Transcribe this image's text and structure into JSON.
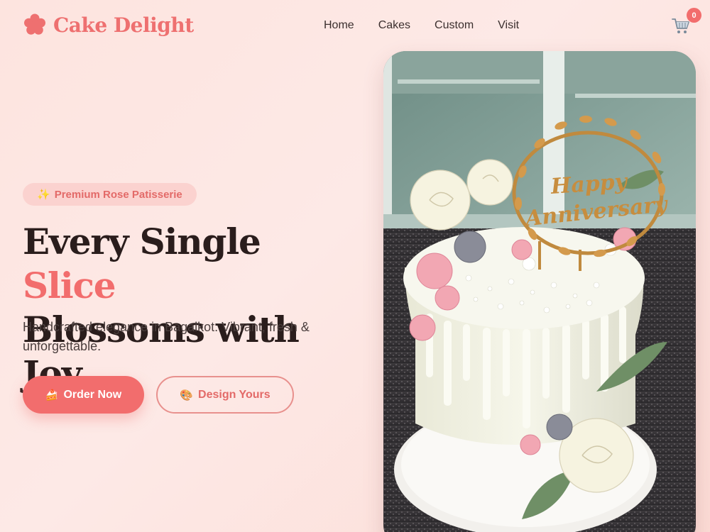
{
  "brand": {
    "name": "Cake Delight",
    "icon": "flower-icon",
    "color": "#ee7070"
  },
  "nav": {
    "items": [
      "Home",
      "Cakes",
      "Custom",
      "Visit"
    ]
  },
  "cart": {
    "icon": "cart-icon",
    "count": "0"
  },
  "hero": {
    "tag": {
      "icon": "sparkles",
      "text": "Premium Rose Patisserie"
    },
    "headline": {
      "part1": "Every Single ",
      "accent": "Slice",
      "line2": "Blossoms with Joy"
    },
    "subtext": "Handcrafted elegance in Bagalkot. Vibrant, fresh & unforgettable.",
    "primary_button": {
      "emoji": "🍰",
      "label": "Order Now"
    },
    "secondary_button": {
      "emoji": "🎨",
      "label": "Design Yours"
    },
    "image": {
      "topper_text_1": "Happy",
      "topper_text_2": "Anniversary"
    }
  },
  "colors": {
    "accent": "#f26d6d",
    "text": "#2a1d1c",
    "background": "#fde4df"
  }
}
